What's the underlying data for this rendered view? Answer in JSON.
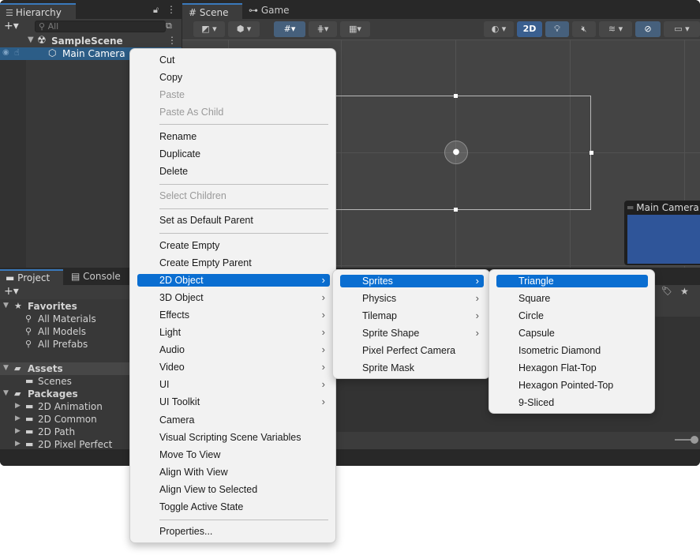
{
  "hierarchy": {
    "tab_label": "Hierarchy",
    "search_placeholder": "All",
    "scene_name": "SampleScene",
    "selected_object": "Main Camera"
  },
  "scene": {
    "scene_tab": "Scene",
    "game_tab": "Game",
    "toolbar_2d_label": "2D",
    "camera_preview_title": "Main Camera"
  },
  "project": {
    "project_tab": "Project",
    "console_tab": "Console",
    "favorites_label": "Favorites",
    "favorites": [
      "All Materials",
      "All Models",
      "All Prefabs"
    ],
    "assets_label": "Assets",
    "assets": [
      "Scenes"
    ],
    "packages_label": "Packages",
    "packages": [
      "2D Animation",
      "2D Common",
      "2D Path",
      "2D Pixel Perfect"
    ]
  },
  "context_menu": {
    "items": [
      {
        "label": "Cut"
      },
      {
        "label": "Copy"
      },
      {
        "label": "Paste",
        "disabled": true
      },
      {
        "label": "Paste As Child",
        "disabled": true
      },
      {
        "label": "Rename"
      },
      {
        "label": "Duplicate"
      },
      {
        "label": "Delete"
      },
      {
        "label": "Select Children",
        "disabled": true
      },
      {
        "label": "Set as Default Parent"
      },
      {
        "label": "Create Empty"
      },
      {
        "label": "Create Empty Parent"
      },
      {
        "label": "2D Object",
        "submenu": true,
        "highlighted": true
      },
      {
        "label": "3D Object",
        "submenu": true
      },
      {
        "label": "Effects",
        "submenu": true
      },
      {
        "label": "Light",
        "submenu": true
      },
      {
        "label": "Audio",
        "submenu": true
      },
      {
        "label": "Video",
        "submenu": true
      },
      {
        "label": "UI",
        "submenu": true
      },
      {
        "label": "UI Toolkit",
        "submenu": true
      },
      {
        "label": "Camera"
      },
      {
        "label": "Visual Scripting Scene Variables"
      },
      {
        "label": "Move To View"
      },
      {
        "label": "Align With View"
      },
      {
        "label": "Align View to Selected"
      },
      {
        "label": "Toggle Active State"
      },
      {
        "label": "Properties..."
      }
    ]
  },
  "submenu_2d": {
    "items": [
      {
        "label": "Sprites",
        "submenu": true,
        "highlighted": true
      },
      {
        "label": "Physics",
        "submenu": true
      },
      {
        "label": "Tilemap",
        "submenu": true
      },
      {
        "label": "Sprite Shape",
        "submenu": true
      },
      {
        "label": "Pixel Perfect Camera"
      },
      {
        "label": "Sprite Mask"
      }
    ]
  },
  "submenu_sprites": {
    "items": [
      {
        "label": "Triangle",
        "highlighted": true
      },
      {
        "label": "Square"
      },
      {
        "label": "Circle"
      },
      {
        "label": "Capsule"
      },
      {
        "label": "Isometric Diamond"
      },
      {
        "label": "Hexagon Flat-Top"
      },
      {
        "label": "Hexagon Pointed-Top"
      },
      {
        "label": "9-Sliced"
      }
    ]
  },
  "colors": {
    "highlight": "#0a6ed1",
    "selection_row": "#2c5d87",
    "camera_preview": "#2f5599"
  }
}
